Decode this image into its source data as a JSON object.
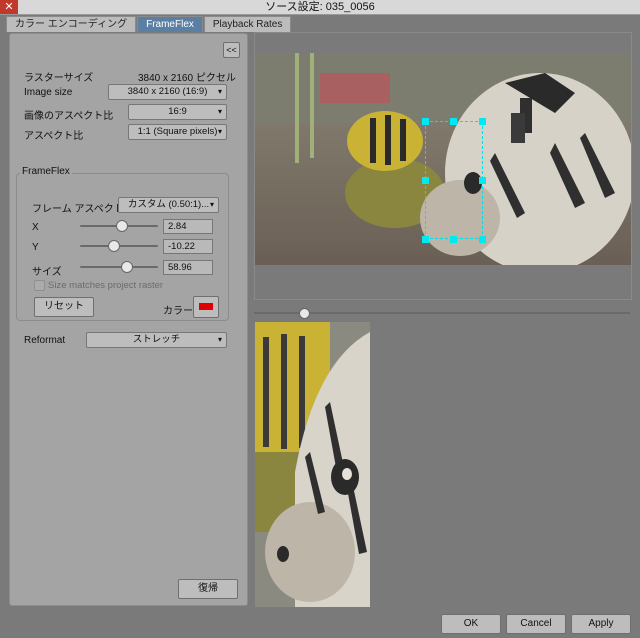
{
  "window": {
    "title": "ソース設定: 035_0056",
    "close_glyph": "✕"
  },
  "tabs": [
    {
      "label": "カラー エンコーディング",
      "active": false
    },
    {
      "label": "FrameFlex",
      "active": true
    },
    {
      "label": "Playback Rates",
      "active": false
    }
  ],
  "panel": {
    "collapse_label": "<<",
    "raster_size_label": "ラスターサイズ",
    "raster_size_value": "3840 x 2160 ピクセル",
    "image_size_label": "Image size",
    "image_size_value": "3840 x 2160 (16:9)",
    "image_aspect_label": "画像のアスペクト比",
    "image_aspect_value": "16:9",
    "aspect_label": "アスペクト比",
    "aspect_value": "1:1 (Square pixels)",
    "frameflex": {
      "group_title": "FrameFlex",
      "frame_aspect_label": "フレーム アスペクト比",
      "frame_aspect_value": "カスタム (0.50:1)...",
      "x_label": "X",
      "x_value": "2.84",
      "x_slider": 0.52,
      "y_label": "Y",
      "y_value": "-10.22",
      "y_slider": 0.42,
      "size_label": "サイズ",
      "size_value": "58.96",
      "size_slider": 0.59,
      "size_matches_label": "Size matches project raster",
      "reset_label": "リセット",
      "color_label": "カラー",
      "color_swatch": "#e00000"
    },
    "reformat_label": "Reformat",
    "reformat_value": "ストレッチ",
    "restore_label": "復帰"
  },
  "preview": {
    "scrub_position": 0.12
  },
  "footer": {
    "ok_label": "OK",
    "cancel_label": "Cancel",
    "apply_label": "Apply"
  },
  "icons": {
    "dropdown": "chevron-down-icon",
    "close": "close-icon"
  }
}
